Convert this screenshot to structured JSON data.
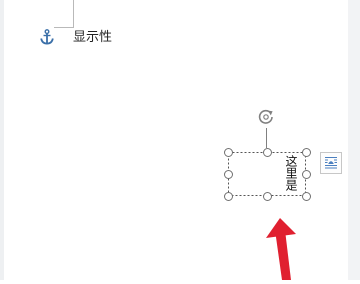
{
  "anchor": {
    "icon": "anchor-icon",
    "label": "显示性"
  },
  "textbox": {
    "text": "这里是"
  },
  "icons": {
    "rotate": "rotate-handle-icon",
    "layout": "layout-options-icon",
    "pointer": "red-arrow-annotation"
  },
  "colors": {
    "anchor": "#3a6fa8",
    "layout_icon": "#4a7fc0",
    "annotation_arrow": "#e02030",
    "handle_border": "#707070"
  }
}
